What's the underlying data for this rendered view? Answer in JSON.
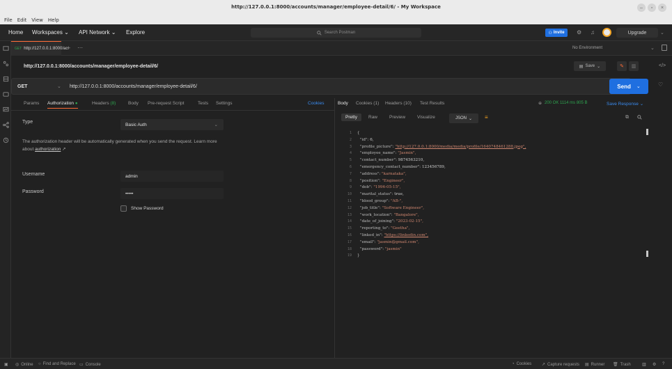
{
  "window": {
    "title": "http://127.0.0.1:8000/accounts/manager/employee-detail/6/ - My Workspace"
  },
  "menubar": {
    "items": [
      "File",
      "Edit",
      "View",
      "Help"
    ]
  },
  "header": {
    "home": "Home",
    "workspaces": "Workspaces",
    "api_network": "API Network",
    "explore": "Explore",
    "search_placeholder": "Search Postman",
    "invite": "Invite",
    "upgrade": "Upgrade"
  },
  "tabbar": {
    "active_tab": "http://127.0.0.1:8000/ac",
    "environment": "No Environment"
  },
  "request": {
    "title_url": "http://127.0.0.1:8000/accounts/manager/employee-detail/6/",
    "save_label": "Save",
    "method": "GET",
    "url": "http://127.0.0.1:8000/accounts/manager/employee-detail/6/",
    "send_label": "Send",
    "tabs": {
      "params": "Params",
      "authorization": "Authorization",
      "headers": "Headers",
      "headers_count": "(8)",
      "body": "Body",
      "prerequest": "Pre-request Script",
      "tests": "Tests",
      "settings": "Settings",
      "cookies": "Cookies"
    }
  },
  "auth": {
    "type_label": "Type",
    "type_value": "Basic Auth",
    "note": "The authorization header will be automatically generated when you send the request. Learn more about",
    "note_link": "authorization",
    "note_arrow": "↗",
    "username_label": "Username",
    "username_value": "admin",
    "password_label": "Password",
    "password_value": "•••••",
    "show_password": "Show Password"
  },
  "response": {
    "tabs": {
      "body": "Body",
      "cookies": "Cookies (1)",
      "headers": "Headers (10)",
      "test_results": "Test Results"
    },
    "status": "200 OK",
    "time": "1114 ms",
    "size": "805 B",
    "save_response": "Save Response",
    "formats": {
      "pretty": "Pretty",
      "raw": "Raw",
      "preview": "Preview",
      "visualize": "Visualize",
      "json": "JSON"
    },
    "lines": [
      {
        "n": "1",
        "key": "",
        "val": "{",
        "link": false
      },
      {
        "n": "2",
        "key": "\"id\": ",
        "val": "6,",
        "link": false
      },
      {
        "n": "3",
        "key": "\"profile_picture\": ",
        "val": "\"http://127.0.0.1:8000/media/media/profile/1640748461288.jpeg\",",
        "link": true
      },
      {
        "n": "4",
        "key": "\"employee_name\": ",
        "val": "\"Jasmin\",",
        "link": false
      },
      {
        "n": "5",
        "key": "\"contact_number\": ",
        "val": "9874563210,",
        "link": false
      },
      {
        "n": "6",
        "key": "\"emergency_contact_number\": ",
        "val": "123456789,",
        "link": false
      },
      {
        "n": "7",
        "key": "\"address\": ",
        "val": "\"karnataka\",",
        "link": false
      },
      {
        "n": "8",
        "key": "\"position\": ",
        "val": "\"Engineer\",",
        "link": false
      },
      {
        "n": "9",
        "key": "\"dob\": ",
        "val": "\"1996-05-15\",",
        "link": false
      },
      {
        "n": "10",
        "key": "\"marital_status\": ",
        "val": "true,",
        "link": false
      },
      {
        "n": "11",
        "key": "\"blood_group\": ",
        "val": "\"AB-\",",
        "link": false
      },
      {
        "n": "12",
        "key": "\"job_title\": ",
        "val": "\"Software Engineer\",",
        "link": false
      },
      {
        "n": "13",
        "key": "\"work_location\": ",
        "val": "\"Bangalore\",",
        "link": false
      },
      {
        "n": "14",
        "key": "\"date_of_joining\": ",
        "val": "\"2023-02-15\",",
        "link": false
      },
      {
        "n": "15",
        "key": "\"reporting_to\": ",
        "val": "\"Geetha\",",
        "link": false
      },
      {
        "n": "16",
        "key": "\"linked_in\": ",
        "val": "\"https://linkedin.com\",",
        "link": true
      },
      {
        "n": "17",
        "key": "\"email\": ",
        "val": "\"jasmin@gmail.com\",",
        "link": false
      },
      {
        "n": "18",
        "key": "\"password\": ",
        "val": "\"jasmin\"",
        "link": false
      },
      {
        "n": "19",
        "key": "",
        "val": "}",
        "link": false
      }
    ]
  },
  "statusbar": {
    "online": "Online",
    "find_replace": "Find and Replace",
    "console": "Console",
    "cookies": "Cookies",
    "capture": "Capture requests",
    "runner": "Runner",
    "trash": "Trash"
  },
  "colors": {
    "accent_orange": "#ff6c37",
    "send_blue": "#1f6fe0",
    "status_green": "#2ea44f"
  }
}
